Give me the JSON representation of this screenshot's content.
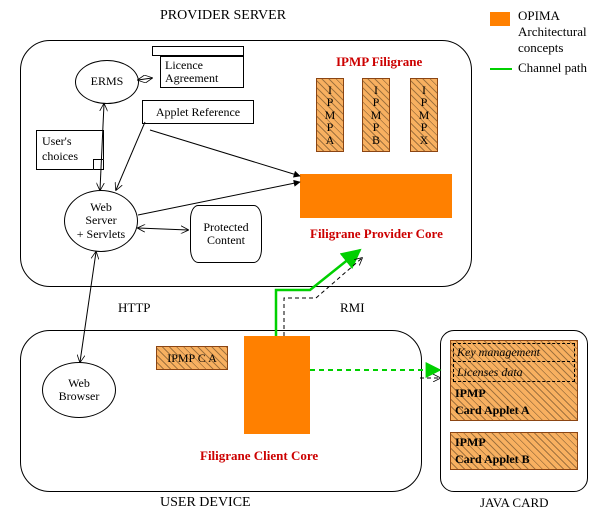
{
  "titles": {
    "provider": "PROVIDER SERVER",
    "user_device": "USER DEVICE",
    "java_card": "JAVA CARD"
  },
  "legend": {
    "opima1": "OPIMA",
    "opima2": "Architectural",
    "opima3": "concepts",
    "channel": "Channel path"
  },
  "provider": {
    "erms": "ERMS",
    "licence1": "Licence",
    "licence2": "Agreement",
    "applet_ref": "Applet Reference",
    "user_choices1": "User's",
    "user_choices2": "choices",
    "web_server1": "Web",
    "web_server2": "Server",
    "web_server3": "+ Servlets",
    "protected1": "Protected",
    "protected2": "Content",
    "ipmp_fil": "IPMP Filigrane",
    "ipmp_a": "I\nP\nM\nP\nA",
    "ipmp_b": "I\nP\nM\nP\nB",
    "ipmp_x": "I\nP\nM\nP\nX",
    "core": "Filigrane Provider Core"
  },
  "middle": {
    "http": "HTTP",
    "rmi": "RMI"
  },
  "user": {
    "browser1": "Web",
    "browser2": "Browser",
    "ipmp_ca": "IPMP C A",
    "core": "Filigrane Client Core"
  },
  "card": {
    "km": "Key management",
    "ld": "Licenses data",
    "a1": "IPMP",
    "a2": "Card Applet A",
    "b1": "IPMP",
    "b2": "Card Applet B"
  }
}
